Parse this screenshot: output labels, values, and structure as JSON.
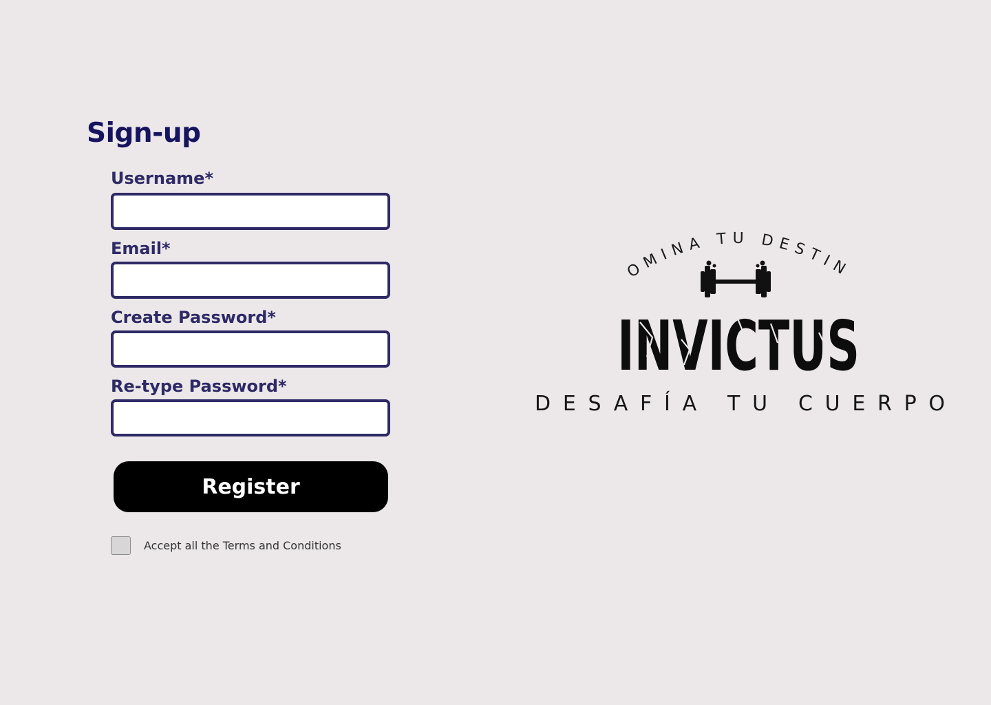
{
  "signup": {
    "title": "Sign-up",
    "fields": [
      {
        "label": "Username*",
        "value": "",
        "placeholder": ""
      },
      {
        "label": "Email*",
        "value": "",
        "placeholder": ""
      },
      {
        "label": "Create Password*",
        "value": "",
        "placeholder": ""
      },
      {
        "label": "Re-type Password*",
        "value": "",
        "placeholder": ""
      }
    ],
    "register_label": "Register",
    "terms_label": "Accept all the Terms and Conditions"
  },
  "logo": {
    "top_arc_text": "DOMINA TU DESTINO",
    "brand_name": "INVICTUS",
    "tagline": "DESAFÍA TU CUERPO",
    "icon": "dumbbell-icon"
  },
  "colors": {
    "background": "#ece8e9",
    "title": "#16145f",
    "label": "#2e2a66",
    "input_border": "#2e2a66",
    "button_bg": "#000000",
    "button_text": "#ffffff"
  }
}
